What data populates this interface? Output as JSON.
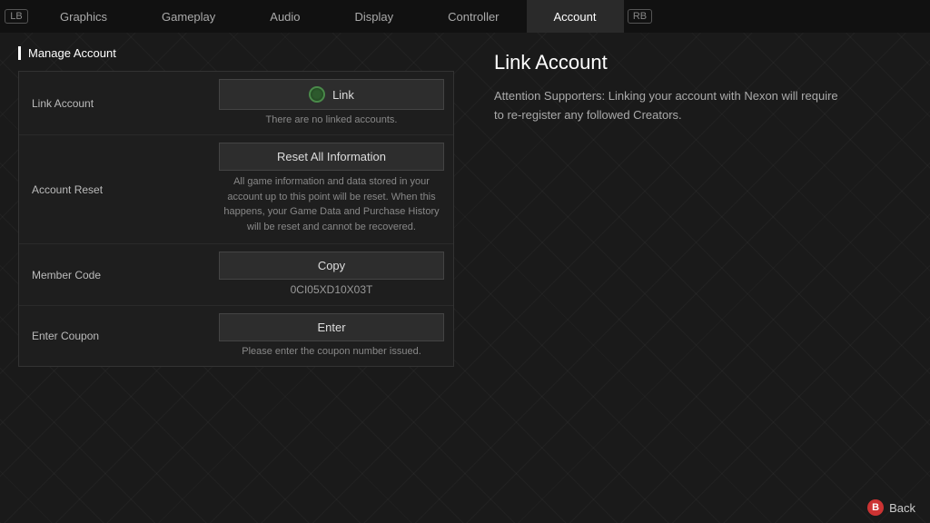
{
  "nav": {
    "lb_label": "LB",
    "rb_label": "RB",
    "items": [
      {
        "id": "graphics",
        "label": "Graphics",
        "active": false
      },
      {
        "id": "gameplay",
        "label": "Gameplay",
        "active": false
      },
      {
        "id": "audio",
        "label": "Audio",
        "active": false
      },
      {
        "id": "display",
        "label": "Display",
        "active": false
      },
      {
        "id": "controller",
        "label": "Controller",
        "active": false
      },
      {
        "id": "account",
        "label": "Account",
        "active": true
      }
    ]
  },
  "left": {
    "section_title": "Manage Account",
    "rows": [
      {
        "id": "link-account",
        "label": "Link Account",
        "button_label": "Link",
        "sub_text": "There are no linked accounts.",
        "has_link_icon": true
      },
      {
        "id": "account-reset",
        "label": "Account Reset",
        "button_label": "Reset All Information",
        "description": "All game information and data stored in your account up to this point will be reset.\nWhen this happens, your Game Data and Purchase History will be reset and cannot be recovered."
      },
      {
        "id": "member-code",
        "label": "Member Code",
        "button_label": "Copy",
        "code_value": "0CI05XD10X03T"
      },
      {
        "id": "enter-coupon",
        "label": "Enter Coupon",
        "button_label": "Enter",
        "sub_text": "Please enter the coupon number issued."
      }
    ]
  },
  "right": {
    "title": "Link Account",
    "description": "Attention Supporters: Linking your account with Nexon will require to re-register any followed Creators."
  },
  "footer": {
    "back_icon": "B",
    "back_label": "Back"
  }
}
